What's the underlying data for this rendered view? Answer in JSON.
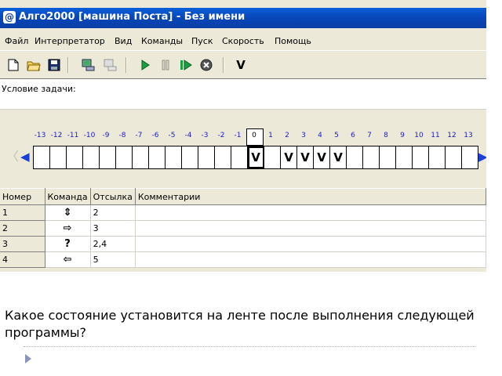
{
  "window": {
    "title": "Алго2000 [машина Поста] - Без имени",
    "app_icon": "@"
  },
  "menu": [
    "Файл",
    "Интерпретатор",
    "Вид",
    "Команды",
    "Пуск",
    "Скорость",
    "Помощь"
  ],
  "toolbar": {
    "icons": [
      "new-file-icon",
      "open-folder-icon",
      "save-icon",
      "computer-icon",
      "computer-disabled-icon",
      "play-icon",
      "pause-icon",
      "step-icon",
      "stop-icon",
      "mark-icon"
    ],
    "mark_label": "V"
  },
  "task": {
    "label": "Условие задачи:"
  },
  "tape": {
    "positions": [
      "-13",
      "-12",
      "-11",
      "-10",
      "-9",
      "-8",
      "-7",
      "-6",
      "-5",
      "-4",
      "-3",
      "-2",
      "-1",
      "0",
      "1",
      "2",
      "3",
      "4",
      "5",
      "6",
      "7",
      "8",
      "9",
      "10",
      "11",
      "12",
      "13"
    ],
    "cells": [
      "",
      "",
      "",
      "",
      "",
      "",
      "",
      "",
      "",
      "",
      "",
      "",
      "",
      "V",
      "",
      "V",
      "V",
      "V",
      "V",
      "",
      "",
      "",
      "",
      "",
      "",
      "",
      ""
    ],
    "head_position": "0"
  },
  "program": {
    "columns": [
      "Номер",
      "Команда",
      "Отсылка",
      "Комментарии"
    ],
    "rows": [
      {
        "num": "1",
        "cmd": "⇕",
        "ref": "2",
        "comment": ""
      },
      {
        "num": "2",
        "cmd": "⇨",
        "ref": "3",
        "comment": ""
      },
      {
        "num": "3",
        "cmd": "?",
        "ref": "2,4",
        "comment": ""
      },
      {
        "num": "4",
        "cmd": "⇦",
        "ref": "5",
        "comment": ""
      }
    ]
  },
  "question": "Какое состояние установится на ленте после выполнения следующей программы?"
}
